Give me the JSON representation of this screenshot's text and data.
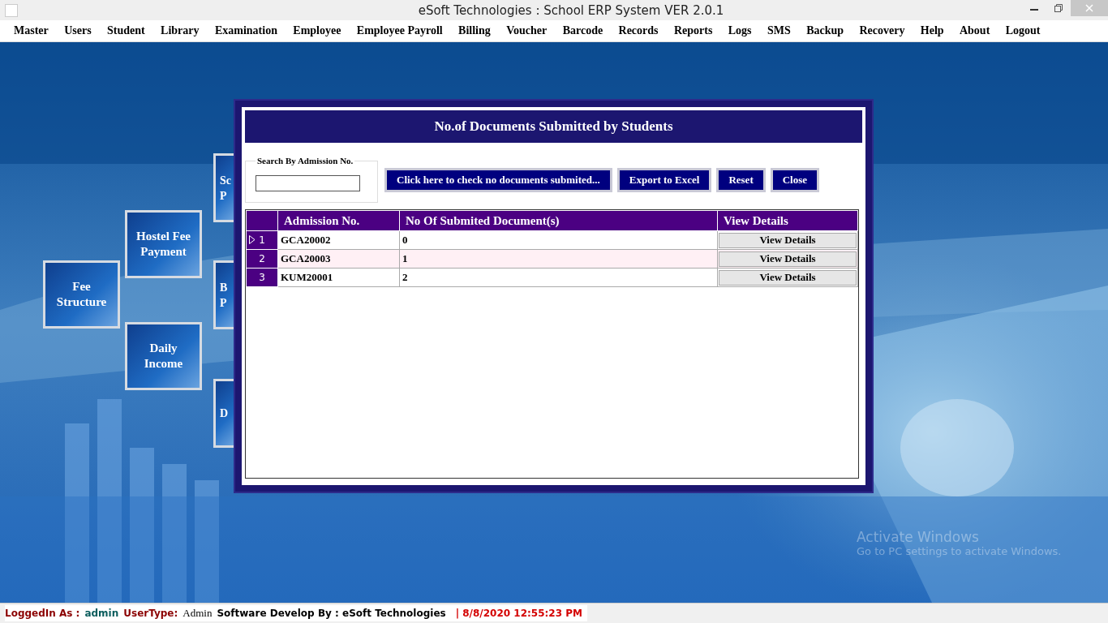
{
  "window": {
    "title": "eSoft Technologies : School ERP System VER 2.0.1"
  },
  "menu": [
    "Master",
    "Users",
    "Student",
    "Library",
    "Examination",
    "Employee",
    "Employee Payroll",
    "Billing",
    "Voucher",
    "Barcode",
    "Records",
    "Reports",
    "Logs",
    "SMS",
    "Backup",
    "Recovery",
    "Help",
    "About",
    "Logout"
  ],
  "tiles": [
    {
      "kind": "full",
      "lines": [
        "Fee",
        "Structure"
      ]
    },
    {
      "kind": "full",
      "lines": [
        "Hostel Fee",
        "Payment"
      ]
    },
    {
      "kind": "full",
      "lines": [
        "Daily",
        "Income"
      ]
    },
    {
      "kind": "partial",
      "lines": [
        "Sc",
        "P"
      ]
    },
    {
      "kind": "partial",
      "lines": [
        "B",
        "P"
      ]
    },
    {
      "kind": "partial",
      "lines": [
        "D"
      ]
    }
  ],
  "dialog": {
    "title": "No.of Documents Submitted by Students",
    "search": {
      "label": "Search By Admission No."
    },
    "buttons": [
      "Click here to check no documents submited...",
      "Export to Excel",
      "Reset",
      "Close"
    ],
    "table": {
      "columns": [
        "Admission No.",
        "No Of Submited Document(s)",
        "View Details"
      ],
      "rows": [
        {
          "number": "1",
          "selected": true,
          "admission_no": "GCA20002",
          "documents": "0",
          "action": "View Details"
        },
        {
          "number": "2",
          "selected": false,
          "admission_no": "GCA20003",
          "documents": "1",
          "action": "View Details"
        },
        {
          "number": "3",
          "selected": false,
          "admission_no": "KUM20001",
          "documents": "2",
          "action": "View Details"
        }
      ]
    }
  },
  "watermark": [
    "Activate Windows",
    "Go to PC settings to activate Windows."
  ],
  "status_bar": [
    {
      "kind": "label",
      "text": "LoggedIn As :"
    },
    {
      "kind": "value",
      "text": "admin"
    },
    {
      "kind": "label",
      "text": "UserType:"
    },
    {
      "kind": "plain",
      "text": "Admin"
    },
    {
      "kind": "credit",
      "text": "Software Develop By : eSoft Technologies"
    },
    {
      "kind": "datetime",
      "text": "| 8/8/2020 12:55:23 PM"
    }
  ]
}
